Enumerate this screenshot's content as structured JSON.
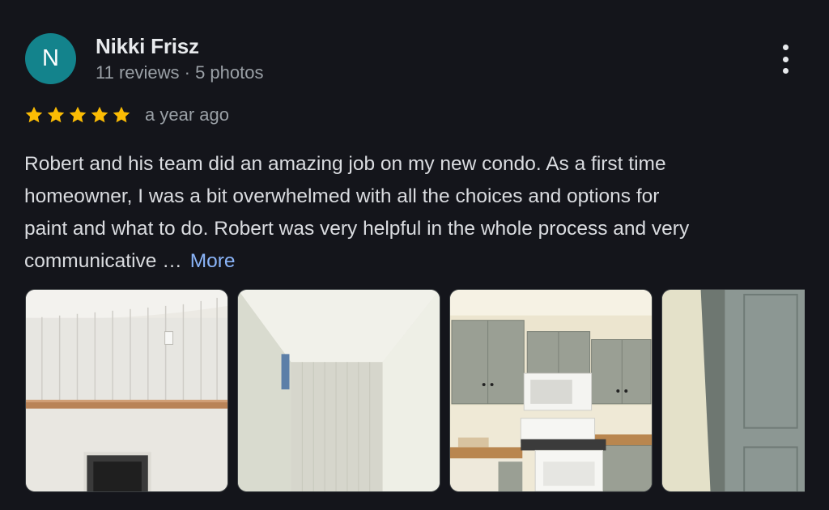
{
  "reviewer": {
    "initial": "N",
    "name": "Nikki Frisz",
    "meta": "11 reviews · 5 photos",
    "avatar_color": "#13838c"
  },
  "rating": {
    "stars": 5,
    "max": 5,
    "star_color": "#fbbc04",
    "time": "a year ago"
  },
  "review": {
    "lines": [
      "Robert and his team did an amazing job on my new condo. As a first time",
      "homeowner, I was a bit overwhelmed with all the choices and options for",
      "paint and what to do. Robert was very helpful in the whole process and very",
      "communicative …"
    ],
    "more_label": "More",
    "link_color": "#8ab4f8"
  },
  "menu": {
    "icon": "more-vert-icon"
  },
  "photos": [
    {
      "subject": "fireplace-wall"
    },
    {
      "subject": "hallway-closet"
    },
    {
      "subject": "kitchen"
    },
    {
      "subject": "door"
    }
  ]
}
